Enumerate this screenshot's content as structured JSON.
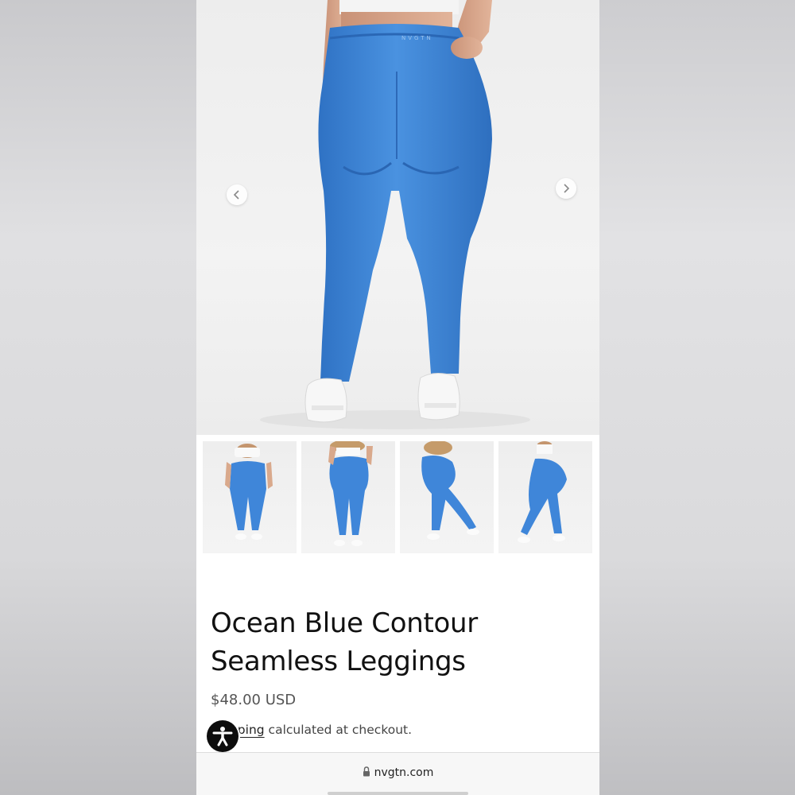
{
  "product": {
    "title_line1": "Ocean Blue Contour",
    "title_line2": "Seamless Leggings",
    "price": "$48.00 USD",
    "shipping_link": "Shipping",
    "shipping_text": " calculated at checkout.",
    "waistband_logo": "NVGTN"
  },
  "gallery": {
    "thumbnails": [
      "front-view",
      "back-view",
      "side-back-view",
      "side-view"
    ],
    "prev_icon": "chevron-left-icon",
    "next_icon": "chevron-right-icon"
  },
  "browser": {
    "url": "nvgtn.com",
    "lock_icon": "lock-icon"
  },
  "accessibility": {
    "icon": "accessibility-icon"
  },
  "colors": {
    "legging_blue": "#3f86d9",
    "text_dark": "#111111",
    "price_gray": "#555555"
  }
}
